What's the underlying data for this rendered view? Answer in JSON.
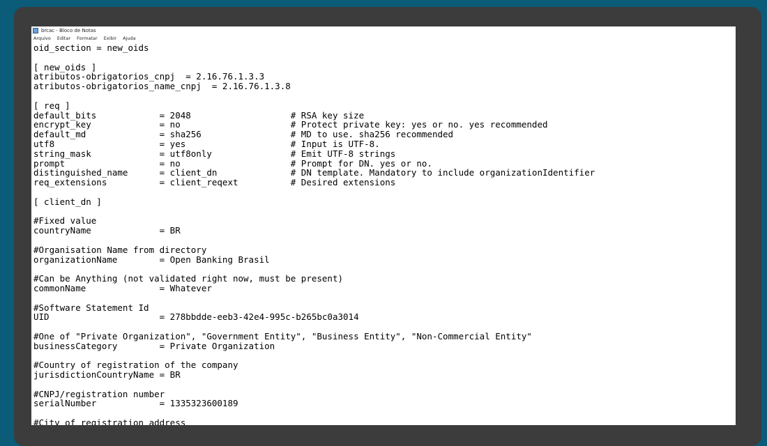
{
  "window": {
    "title": "brcac - Bloco de Notas"
  },
  "menu": [
    "Arquivo",
    "Editar",
    "Formatar",
    "Exibir",
    "Ajuda"
  ],
  "editor": {
    "lines": [
      "oid_section = new_oids",
      "",
      "[ new_oids ]",
      "atributos-obrigatorios_cnpj  = 2.16.76.1.3.3",
      "atributos-obrigatorios_name_cnpj  = 2.16.76.1.3.8",
      "",
      "[ req ]",
      "default_bits            = 2048                   # RSA key size",
      "encrypt_key             = no                     # Protect private key: yes or no. yes recommended",
      "default_md              = sha256                 # MD to use. sha256 recommended",
      "utf8                    = yes                    # Input is UTF-8.",
      "string_mask             = utf8only               # Emit UTF-8 strings",
      "prompt                  = no                     # Prompt for DN. yes or no.",
      "distinguished_name      = client_dn              # DN template. Mandatory to include organizationIdentifier",
      "req_extensions          = client_reqext          # Desired extensions",
      "",
      "[ client_dn ]",
      "",
      "#Fixed value",
      "countryName             = BR",
      "",
      "#Organisation Name from directory",
      "organizationName        = Open Banking Brasil",
      "",
      "#Can be Anything (not validated right now, must be present)",
      "commonName              = Whatever",
      "",
      "#Software Statement Id",
      "UID                     = 278bbdde-eeb3-42e4-995c-b265bc0a3014",
      "",
      "#One of \"Private Organization\", \"Government Entity\", \"Business Entity\", \"Non-Commercial Entity\"",
      "businessCategory        = Private Organization",
      "",
      "#Country of registration of the company",
      "jurisdictionCountryName = BR",
      "",
      "#CNPJ/registration number",
      "serialNumber            = 1335323600189",
      "",
      "#City of registration address"
    ]
  }
}
